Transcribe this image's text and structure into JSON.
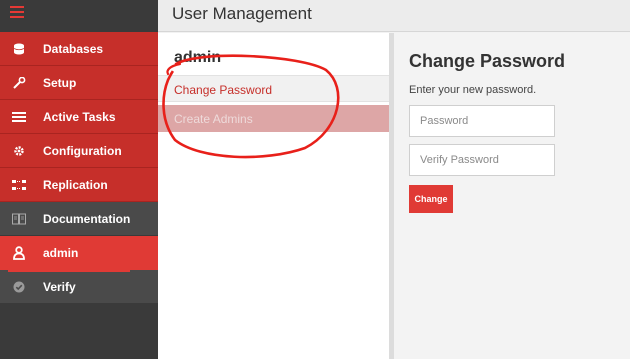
{
  "header": {
    "title": "User Management"
  },
  "sidebar": {
    "items": [
      {
        "label": "Databases",
        "icon": "database-icon"
      },
      {
        "label": "Setup",
        "icon": "wrench-icon"
      },
      {
        "label": "Active Tasks",
        "icon": "tasks-icon"
      },
      {
        "label": "Configuration",
        "icon": "gear-icon"
      },
      {
        "label": "Replication",
        "icon": "replication-icon"
      },
      {
        "label": "Documentation",
        "icon": "book-icon"
      },
      {
        "label": "admin",
        "icon": "user-icon"
      },
      {
        "label": "Verify",
        "icon": "check-circle-icon"
      }
    ]
  },
  "middle": {
    "title": "admin",
    "items": [
      {
        "label": "Change Password"
      },
      {
        "label": "Create Admins"
      }
    ]
  },
  "panel": {
    "title": "Change Password",
    "subtitle": "Enter your new password.",
    "password_placeholder": "Password",
    "verify_placeholder": "Verify Password",
    "button_label": "Change"
  },
  "colors": {
    "sidebar_red": "#c62f2a",
    "active_red": "#e03a35",
    "sidebar_grey": "#4a4a4a",
    "annotation_red": "#e8201a"
  }
}
